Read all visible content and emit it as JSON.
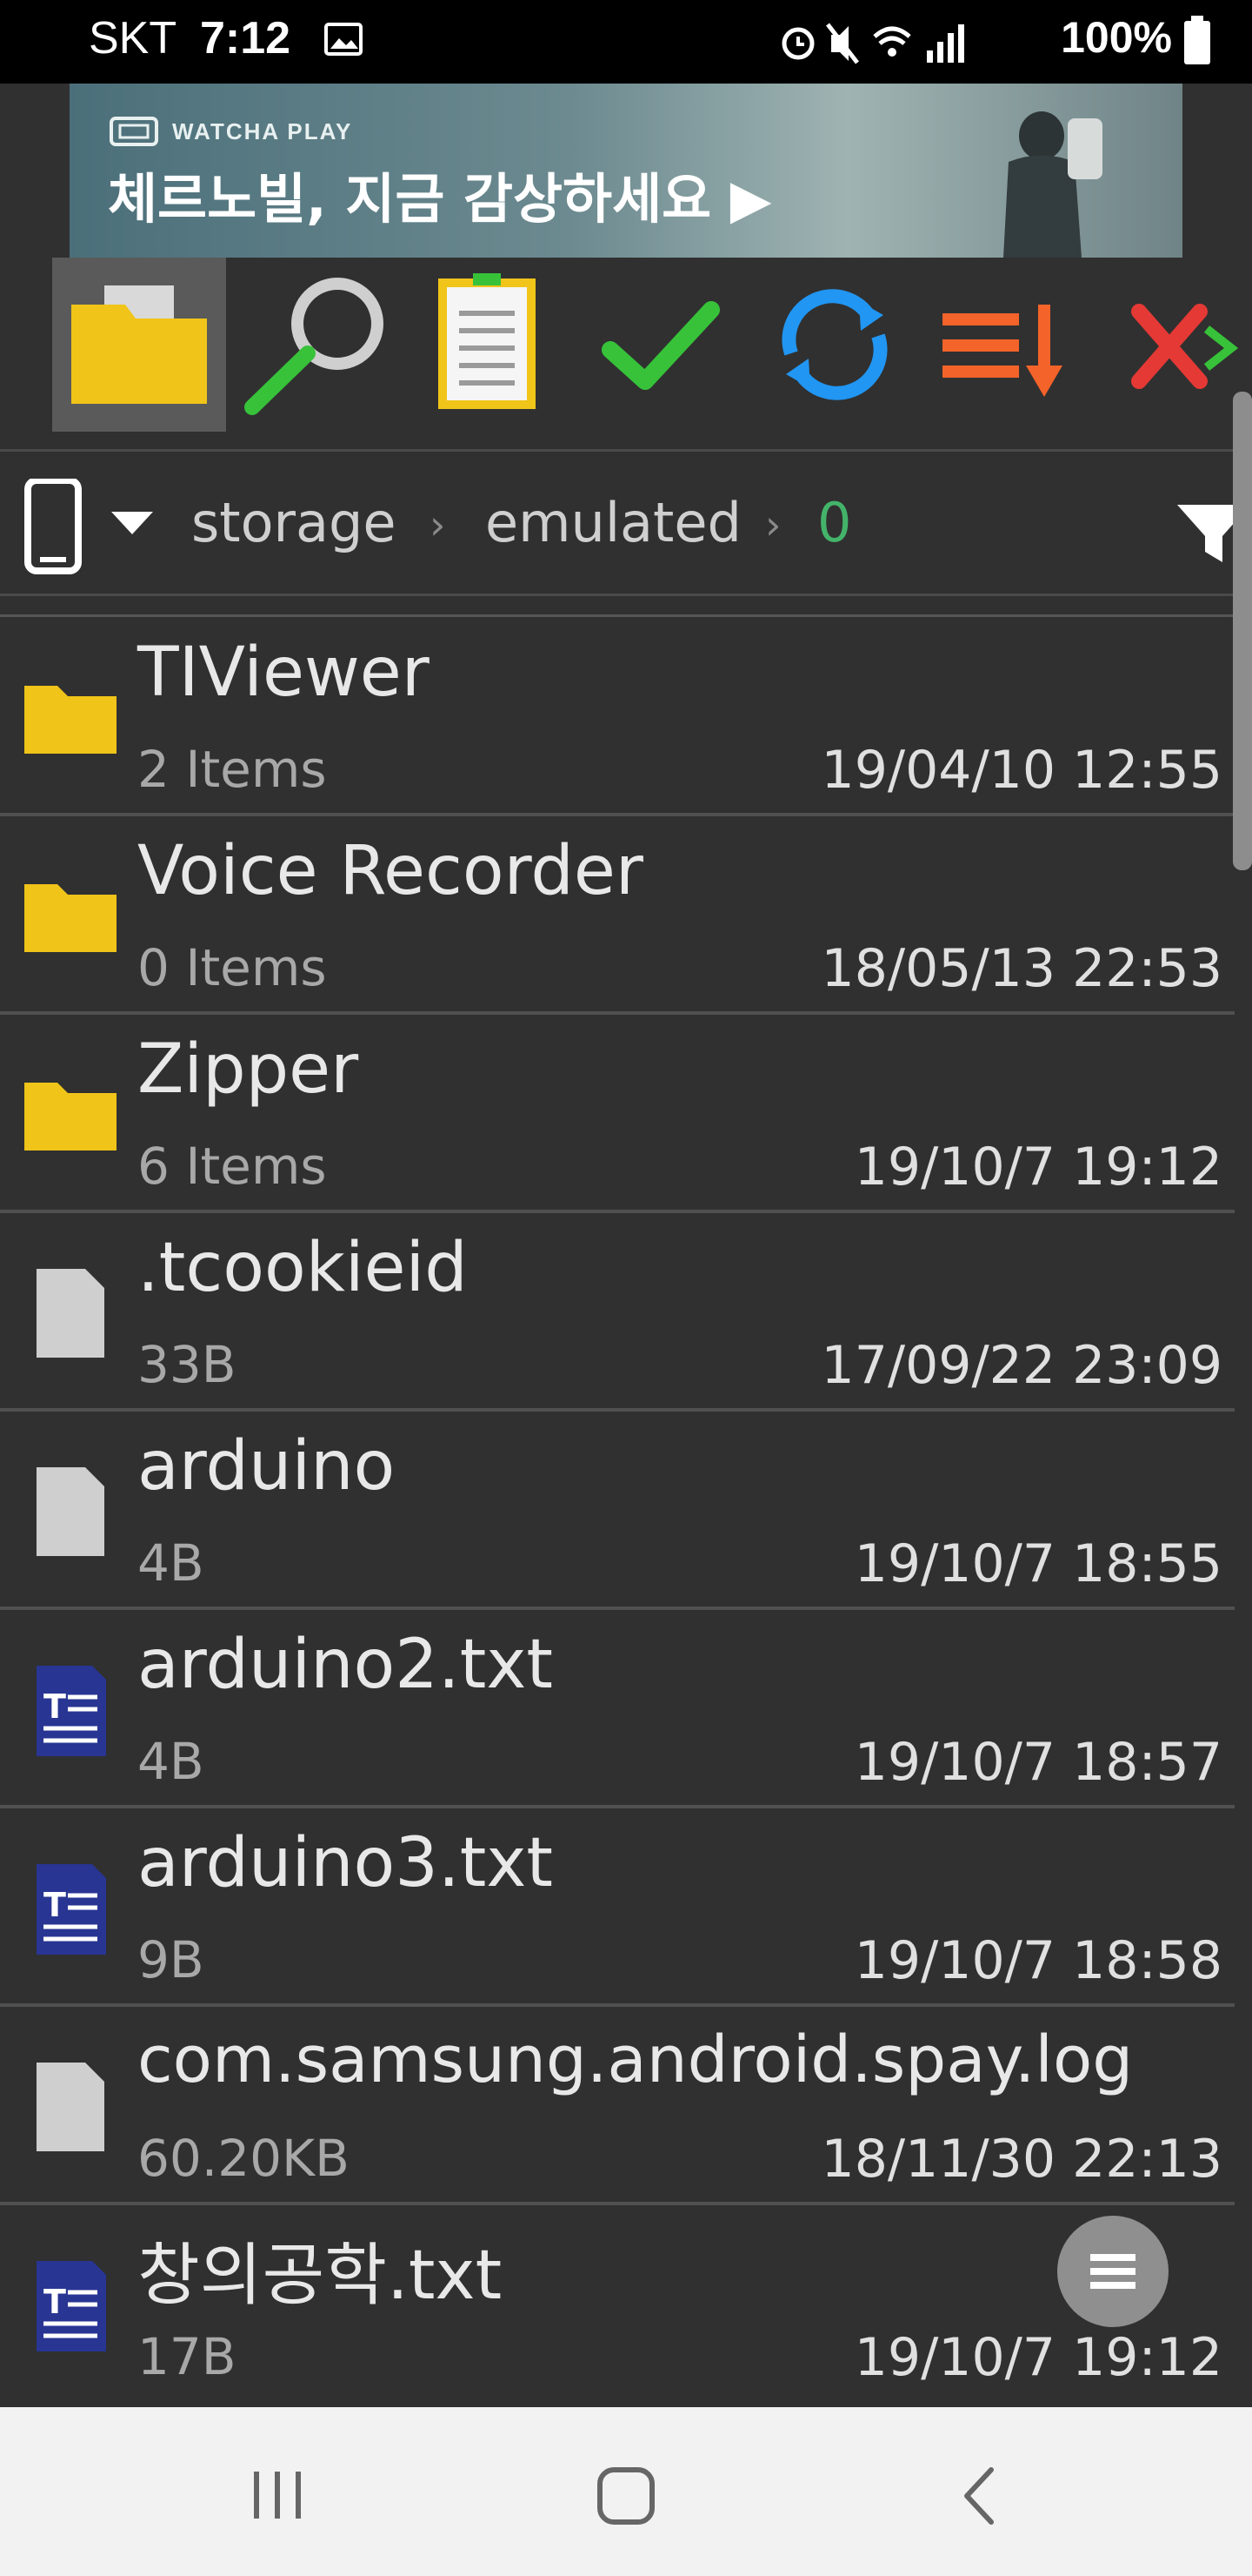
{
  "status_bar": {
    "carrier": "SKT",
    "time": "7:12",
    "battery": "100%"
  },
  "ad": {
    "brand": "WATCHA PLAY",
    "title": "체르노빌, 지금 감상하세요 ▶"
  },
  "toolbar": {
    "buttons": [
      "folder-icon",
      "search-icon",
      "clipboard-icon",
      "checkmark-icon",
      "refresh-icon",
      "sort-icon",
      "close-arrow-icon"
    ]
  },
  "path": {
    "segments": [
      "storage",
      "emulated",
      "0"
    ],
    "accent_color": "#44b36a"
  },
  "files": [
    {
      "name": "TIViewer",
      "meta": "2 Items",
      "date": "19/04/10 12:55",
      "type": "folder"
    },
    {
      "name": "Voice Recorder",
      "meta": "0 Items",
      "date": "18/05/13 22:53",
      "type": "folder"
    },
    {
      "name": "Zipper",
      "meta": "6 Items",
      "date": "19/10/7 19:12",
      "type": "folder"
    },
    {
      "name": ".tcookieid",
      "meta": "33B",
      "date": "17/09/22 23:09",
      "type": "file"
    },
    {
      "name": "arduino",
      "meta": "4B",
      "date": "19/10/7 18:55",
      "type": "file"
    },
    {
      "name": "arduino2.txt",
      "meta": "4B",
      "date": "19/10/7 18:57",
      "type": "text"
    },
    {
      "name": "arduino3.txt",
      "meta": "9B",
      "date": "19/10/7 18:58",
      "type": "text"
    },
    {
      "name": "com.samsung.android.spay.log",
      "meta": "60.20KB",
      "date": "18/11/30 22:13",
      "type": "file"
    },
    {
      "name": "창의공학.txt",
      "meta": "17B",
      "date": "19/10/7 19:12",
      "type": "text"
    }
  ],
  "colors": {
    "folder": "#f0c419",
    "file": "#cfcfcf",
    "text_icon": "#283593"
  }
}
